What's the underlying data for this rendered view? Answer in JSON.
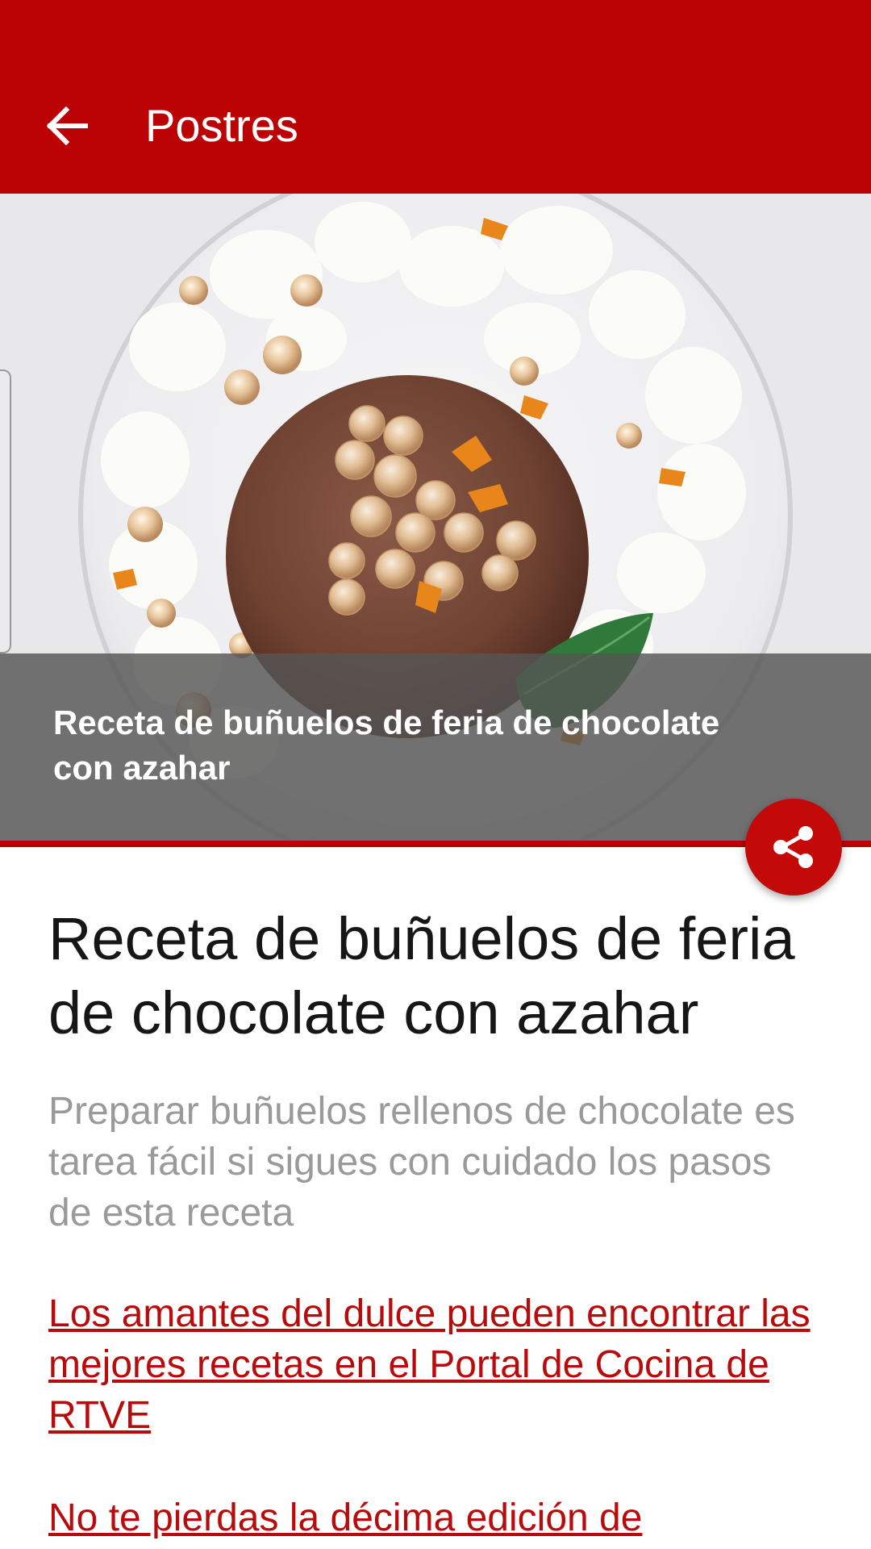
{
  "colors": {
    "app_bar": "#bb0205",
    "accent": "#c40909",
    "link": "#b80b0b",
    "subtitle": "#9a9a9a"
  },
  "app_bar": {
    "back_icon": "arrow-left-icon",
    "title": "Postres"
  },
  "hero": {
    "image": "chocolate-dessert-photo",
    "caption": "Receta de buñuelos de feria de chocolate con azahar"
  },
  "share": {
    "icon": "share-icon"
  },
  "article": {
    "title": "Receta de buñuelos de feria de chocolate con azahar",
    "subtitle": "Preparar buñuelos rellenos de chocolate es tarea fácil si sigues con cuidado los pasos de esta receta",
    "links": [
      "Los amantes del dulce pueden encontrar las mejores recetas en el Portal de Cocina de RTVE",
      "No te pierdas la décima edición de"
    ]
  }
}
